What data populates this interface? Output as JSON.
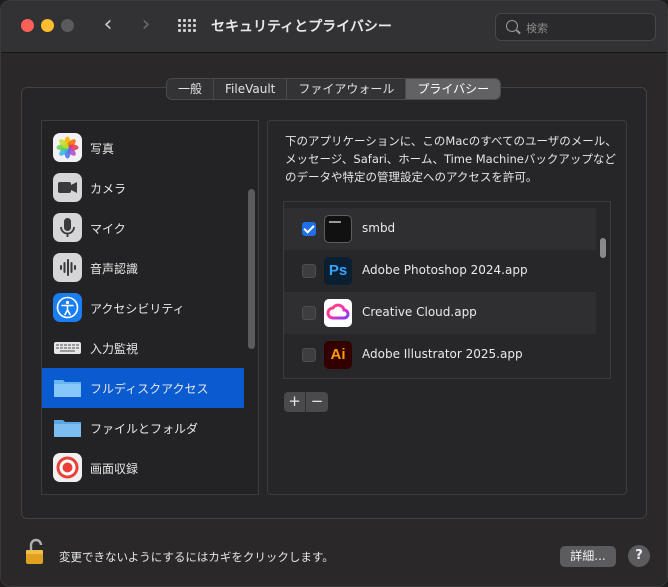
{
  "window": {
    "title": "セキュリティとプライバシー",
    "search_placeholder": "検索"
  },
  "tabs": [
    {
      "label": "一般",
      "active": false
    },
    {
      "label": "FileVault",
      "active": false
    },
    {
      "label": "ファイアウォール",
      "active": false
    },
    {
      "label": "プライバシー",
      "active": true
    }
  ],
  "sidebar": {
    "items": [
      {
        "label": "写真",
        "icon": "photos-icon"
      },
      {
        "label": "カメラ",
        "icon": "camera-icon"
      },
      {
        "label": "マイク",
        "icon": "microphone-icon"
      },
      {
        "label": "音声認識",
        "icon": "speech-recognition-icon"
      },
      {
        "label": "アクセシビリティ",
        "icon": "accessibility-icon"
      },
      {
        "label": "入力監視",
        "icon": "keyboard-icon"
      },
      {
        "label": "フルディスクアクセス",
        "icon": "folder-icon",
        "selected": true
      },
      {
        "label": "ファイルとフォルダ",
        "icon": "folder-icon"
      },
      {
        "label": "画面収録",
        "icon": "screen-recording-icon"
      }
    ]
  },
  "detail": {
    "description": "下のアプリケーションに、このMacのすべてのユーザのメール、メッセージ、Safari、ホーム、Time Machineバックアップなどのデータや特定の管理設定へのアクセスを許可。",
    "apps": [
      {
        "name": "smbd",
        "checked": true,
        "icon": "terminal-icon"
      },
      {
        "name": "Adobe Photoshop 2024.app",
        "checked": false,
        "icon": "photoshop-icon",
        "icon_text": "Ps"
      },
      {
        "name": "Creative Cloud.app",
        "checked": false,
        "icon": "creative-cloud-icon"
      },
      {
        "name": "Adobe Illustrator 2025.app",
        "checked": false,
        "icon": "illustrator-icon",
        "icon_text": "Ai"
      }
    ],
    "add_label": "+",
    "remove_label": "−"
  },
  "footer": {
    "lock_text": "変更できないようにするにはカギをクリックします。",
    "details_label": "詳細...",
    "help_label": "?"
  },
  "colors": {
    "accent": "#0a5ad0",
    "checkbox": "#1f6fe5"
  }
}
